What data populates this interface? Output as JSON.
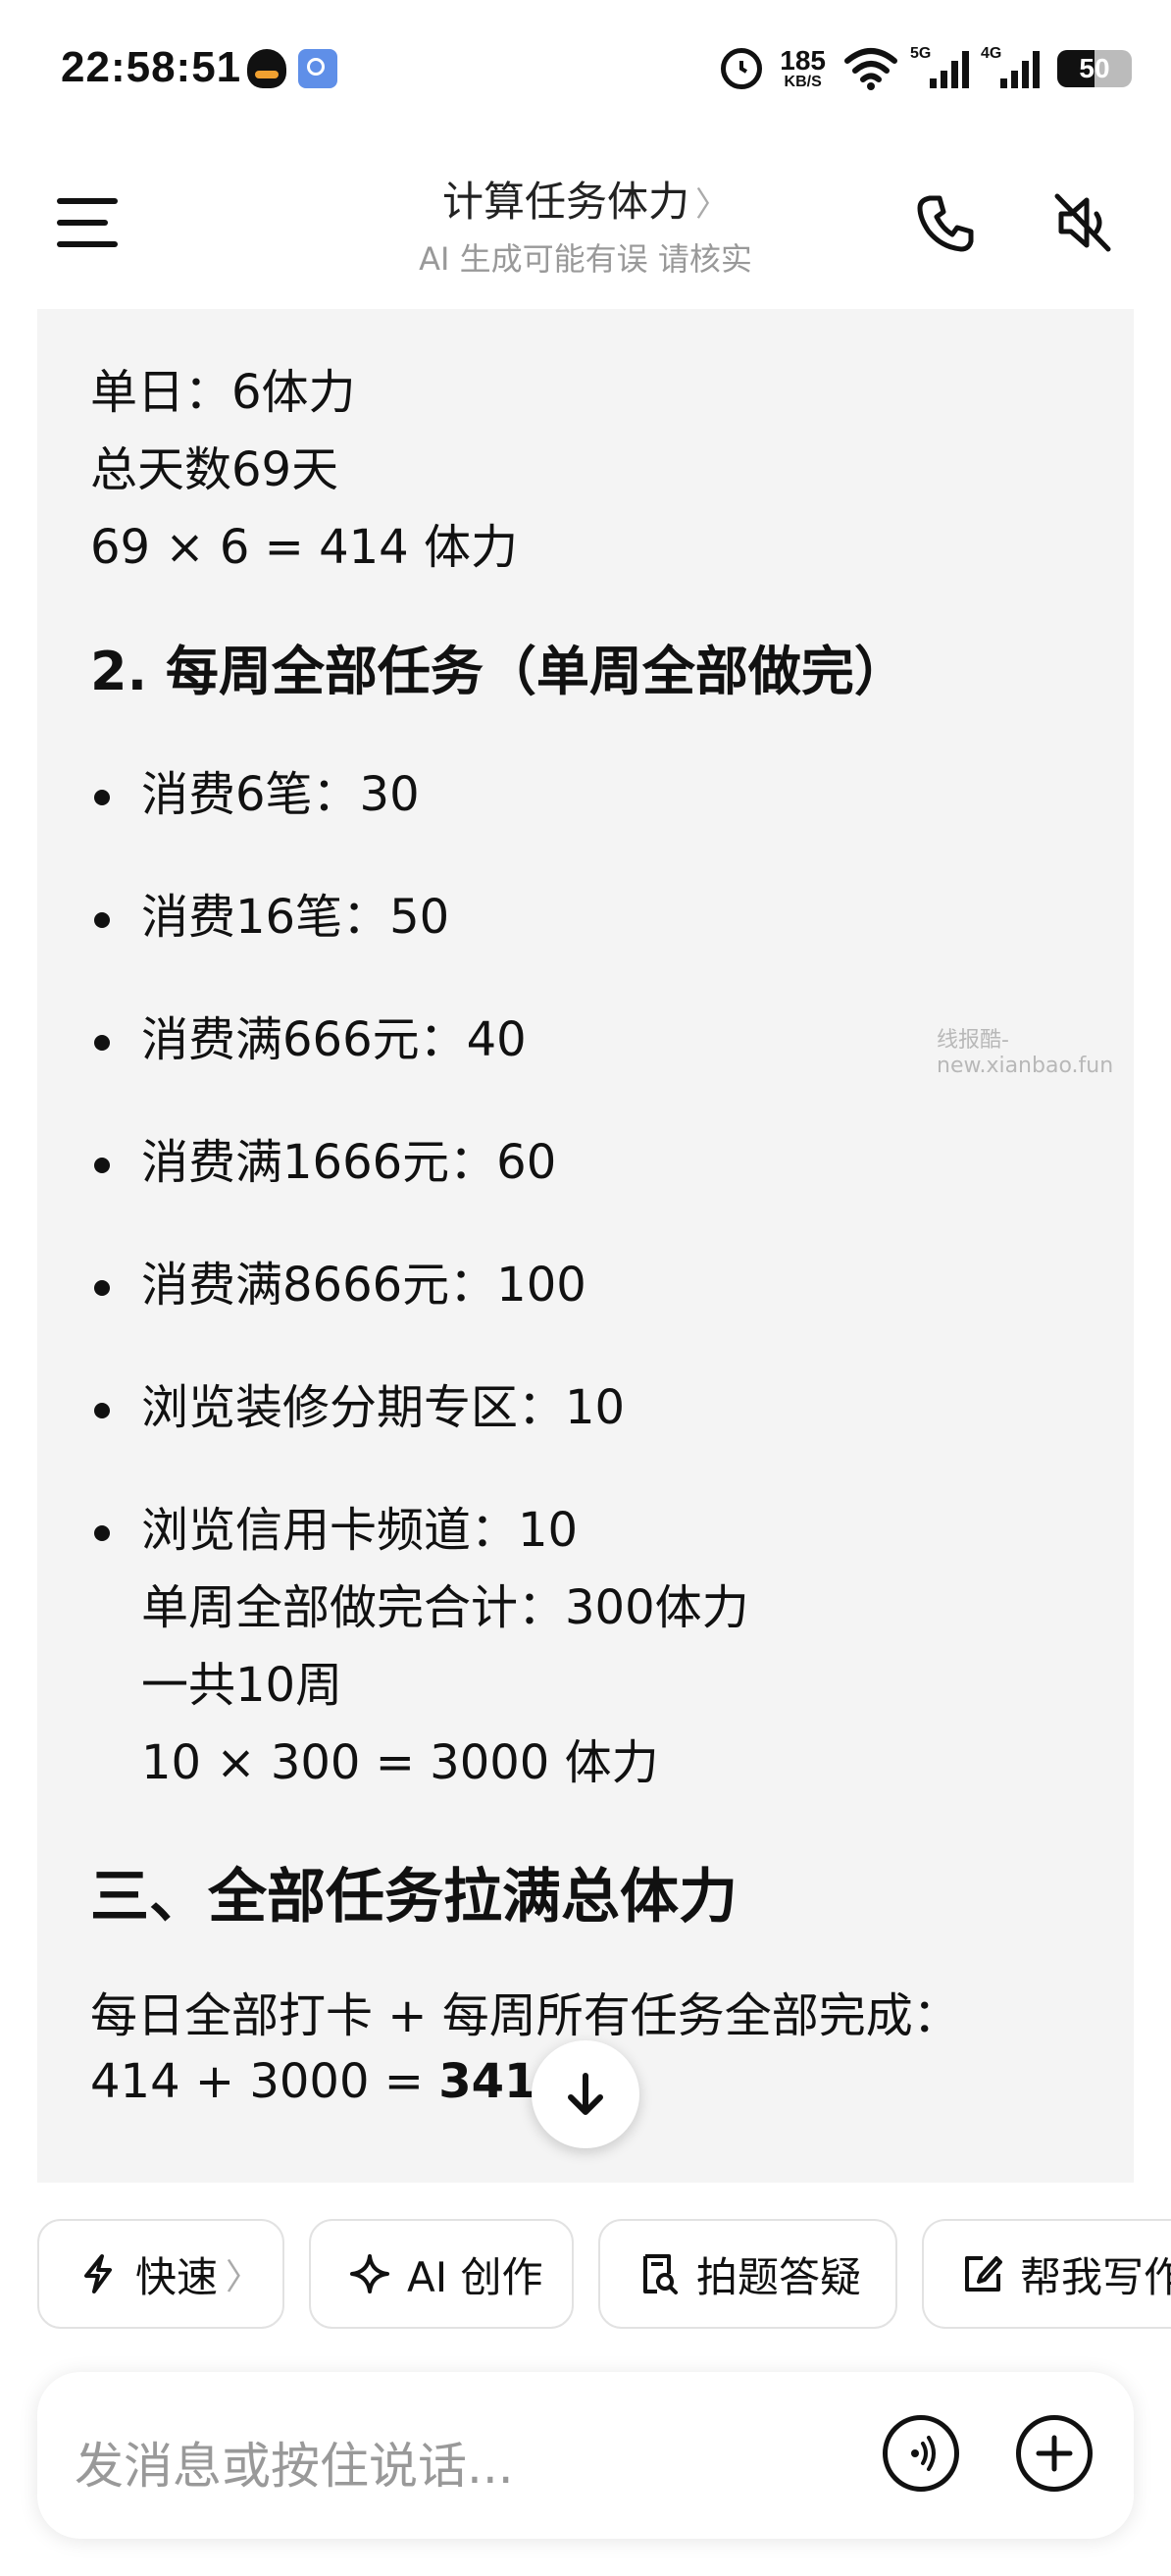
{
  "status_bar": {
    "time": "22:58:51",
    "net_speed": "185",
    "net_unit": "KB/S",
    "sig1_label": "5G",
    "sig2_label": "4G",
    "battery": "50",
    "battery_level": 0.5
  },
  "header": {
    "title": "计算任务体力",
    "title_chevron": "〉",
    "subtitle": "AI 生成可能有误 请核实"
  },
  "content": {
    "line_daily": "单日：6体力",
    "line_days": "总天数69天",
    "line_daily_calc": "69 × 6 = 414 体力",
    "section2_heading": "2. 每周全部任务（单周全部做完）",
    "weekly_items": [
      "消费6笔：30",
      "消费16笔：50",
      "消费满666元：40",
      "消费满1666元：60",
      "消费满8666元：100",
      "浏览装修分期专区：10",
      "浏览信用卡频道：10"
    ],
    "weekly_total": "单周全部做完合计：300体力",
    "weeks": "一共10周",
    "weekly_calc": "10 × 300 = 3000 体力",
    "section3_heading": "三、全部任务拉满总体力",
    "summary_line": "每日全部打卡 + 每周所有任务全部完成：",
    "summary_calc_prefix": "414 + 3000 = ",
    "summary_calc_bold": "3414 "
  },
  "watermark": "线报酷-new.xianbao.fun",
  "chips": {
    "fast": "快速",
    "fast_chevron": "〉",
    "ai_create": "AI 创作",
    "photo_qa": "拍题答疑",
    "write": "帮我写作"
  },
  "input": {
    "placeholder": "发消息或按住说话..."
  },
  "icons": {
    "menu": "menu-icon",
    "call": "phone-icon",
    "speaker": "speaker-muted-icon",
    "scroll": "arrow-down-icon",
    "voice": "voice-wave-icon",
    "plus": "plus-icon"
  }
}
